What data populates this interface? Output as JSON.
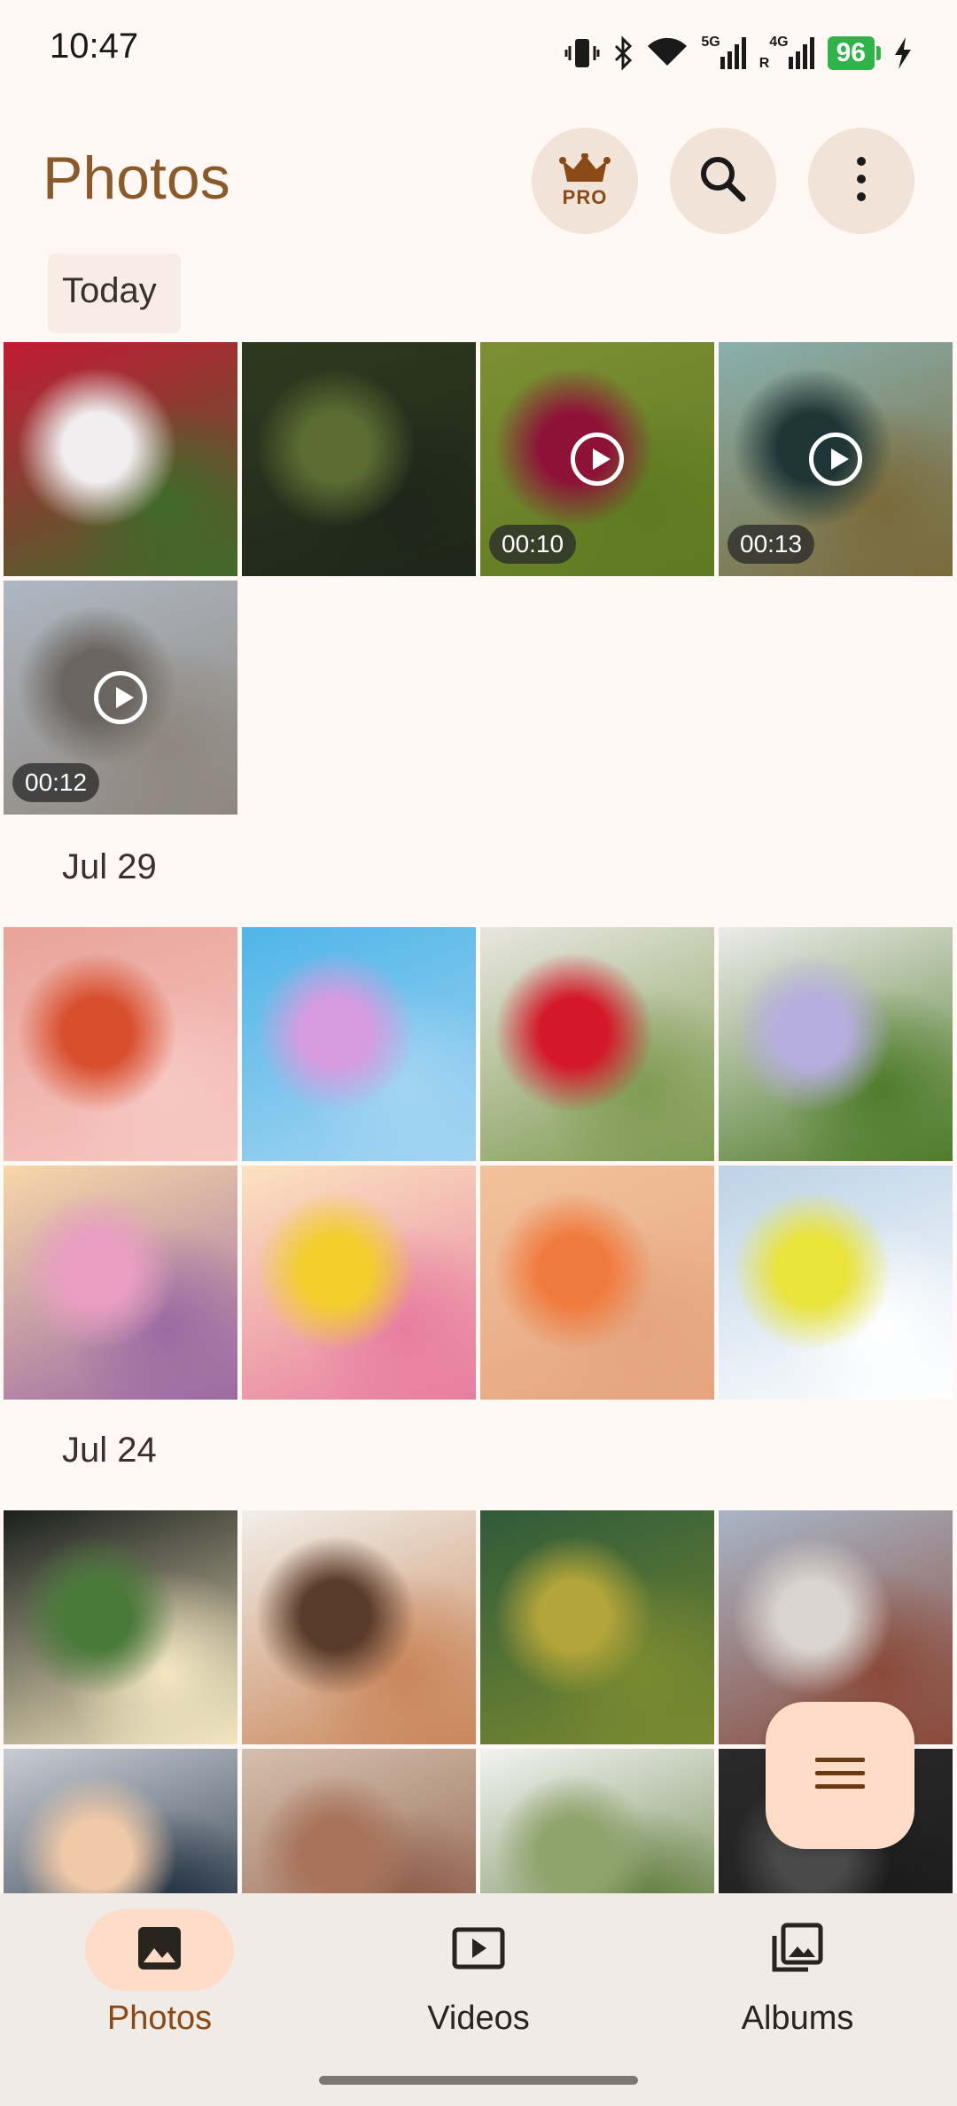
{
  "status_bar": {
    "time": "10:47",
    "battery": "96",
    "network1": "5G",
    "network2": "4G",
    "roaming": "R",
    "icons": [
      "vibrate-icon",
      "bluetooth-icon",
      "wifi-icon",
      "signal-5g-icon",
      "signal-4g-icon",
      "battery-icon",
      "charging-icon"
    ]
  },
  "app_bar": {
    "title": "Photos",
    "pro_label": "PRO",
    "icons": [
      "crown-icon",
      "search-icon",
      "more-vert-icon"
    ]
  },
  "sections": [
    {
      "label": "Today",
      "items": [
        {
          "type": "photo",
          "colors": [
            "#c31a35",
            "#f1eef0",
            "#3f6a2a"
          ]
        },
        {
          "type": "photo",
          "colors": [
            "#2d3a1f",
            "#5b6d33",
            "#1f261a"
          ]
        },
        {
          "type": "video",
          "duration": "00:10",
          "colors": [
            "#7d8f33",
            "#8e1238",
            "#5d7a22"
          ]
        },
        {
          "type": "video",
          "duration": "00:13",
          "colors": [
            "#8ab0ae",
            "#1f3637",
            "#7a6a3a"
          ]
        },
        {
          "type": "video",
          "duration": "00:12",
          "colors": [
            "#aeb7c2",
            "#6b6560",
            "#8f877e"
          ]
        }
      ]
    },
    {
      "label": "Jul 29",
      "items": [
        {
          "type": "photo",
          "colors": [
            "#e8a39a",
            "#d84f2e",
            "#f7c7c2"
          ]
        },
        {
          "type": "photo",
          "colors": [
            "#4fb5e8",
            "#d69be0",
            "#a3d4f2"
          ]
        },
        {
          "type": "photo",
          "colors": [
            "#e8e6e0",
            "#d41829",
            "#7f9b52"
          ]
        },
        {
          "type": "photo",
          "colors": [
            "#ecebea",
            "#b7aee0",
            "#4f7b2a"
          ]
        },
        {
          "type": "photo",
          "colors": [
            "#f6d8a8",
            "#e99ec2",
            "#9b6aa3"
          ]
        },
        {
          "type": "photo",
          "colors": [
            "#fbe3c0",
            "#f2cf2c",
            "#e77da0"
          ]
        },
        {
          "type": "photo",
          "colors": [
            "#f2c29d",
            "#f07a3e",
            "#e4a47e"
          ]
        },
        {
          "type": "photo",
          "colors": [
            "#bcd2e6",
            "#e9e33a",
            "#ffffff"
          ]
        }
      ]
    },
    {
      "label": "Jul 24",
      "items": [
        {
          "type": "photo",
          "colors": [
            "#1a1f1c",
            "#4a7a3a",
            "#f4e7c2"
          ]
        },
        {
          "type": "photo",
          "colors": [
            "#f1efea",
            "#5a3a2a",
            "#c9865a"
          ]
        },
        {
          "type": "photo",
          "colors": [
            "#2f5a3a",
            "#b3a53a",
            "#7a8a30"
          ]
        },
        {
          "type": "photo",
          "colors": [
            "#a8b5c6",
            "#d9d4cf",
            "#8a4a3a"
          ]
        },
        {
          "type": "photo",
          "colors": [
            "#c9cdd4",
            "#f0c9a8",
            "#1a2a3a"
          ]
        },
        {
          "type": "photo",
          "colors": [
            "#d5bfae",
            "#a8735a",
            "#8a5a46"
          ]
        },
        {
          "type": "photo",
          "colors": [
            "#f3f3f2",
            "#8fa36c",
            "#5d7a3a"
          ]
        },
        {
          "type": "photo",
          "colors": [
            "#2a2a2a",
            "#4a4a4a",
            "#1a1a1a"
          ]
        }
      ]
    }
  ],
  "fab": {
    "icon": "menu-icon"
  },
  "bottom_nav": [
    {
      "label": "Photos",
      "icon": "image-icon",
      "active": true
    },
    {
      "label": "Videos",
      "icon": "play-box-icon",
      "active": false
    },
    {
      "label": "Albums",
      "icon": "albums-icon",
      "active": false
    }
  ]
}
